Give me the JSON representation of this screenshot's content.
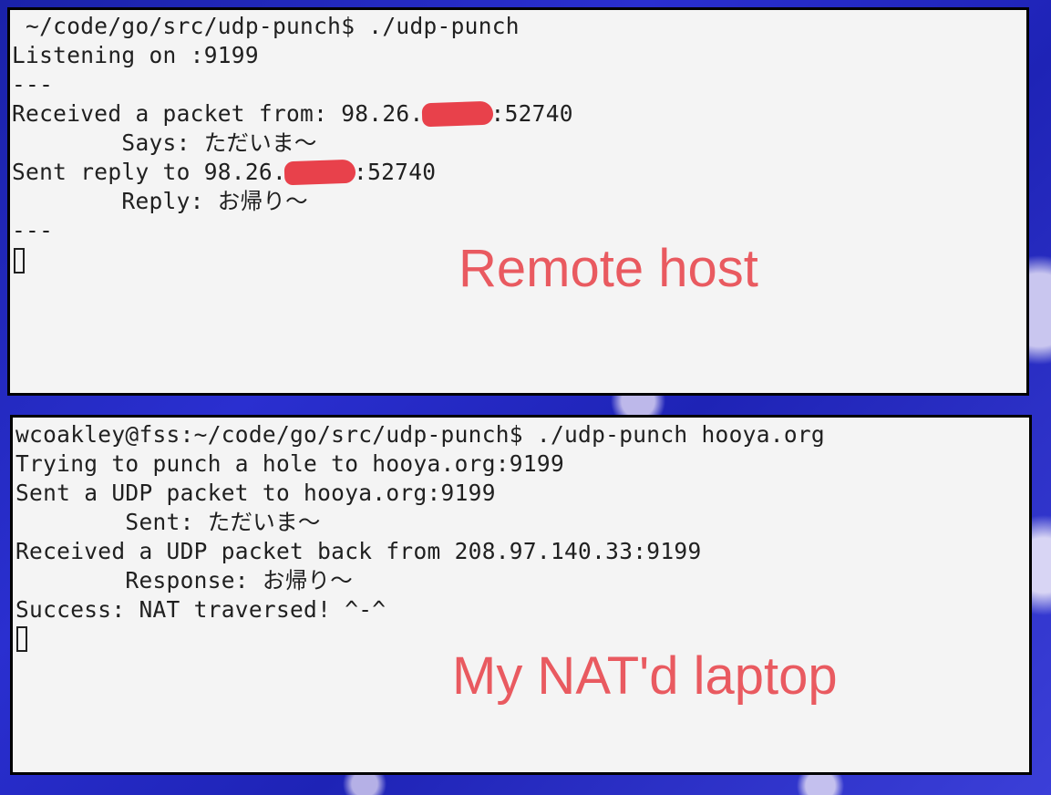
{
  "remote_terminal": {
    "lines": [
      " ~/code/go/src/udp-punch$ ./udp-punch",
      "Listening on :9199",
      "---",
      "Says: ただいま〜",
      "Reply: お帰り〜",
      "---"
    ],
    "received_prefix": "Received a packet from: 98.26.",
    "received_suffix": ":52740",
    "sent_prefix": "Sent reply to 98.26.",
    "sent_suffix": ":52740",
    "annotation": "Remote host"
  },
  "laptop_terminal": {
    "lines": [
      "wcoakley@fss:~/code/go/src/udp-punch$ ./udp-punch hooya.org",
      "Trying to punch a hole to hooya.org:9199",
      "Sent a UDP packet to hooya.org:9199",
      "        Sent: ただいま〜",
      "Received a UDP packet back from 208.97.140.33:9199",
      "        Response: お帰り〜",
      "Success: NAT traversed! ^-^"
    ],
    "annotation": "My NAT'd laptop"
  },
  "colors": {
    "annotation": "#e95a60",
    "redaction": "#e8414b",
    "terminal_bg": "#f4f4f4",
    "desktop_bg": "#2a2fd0"
  }
}
